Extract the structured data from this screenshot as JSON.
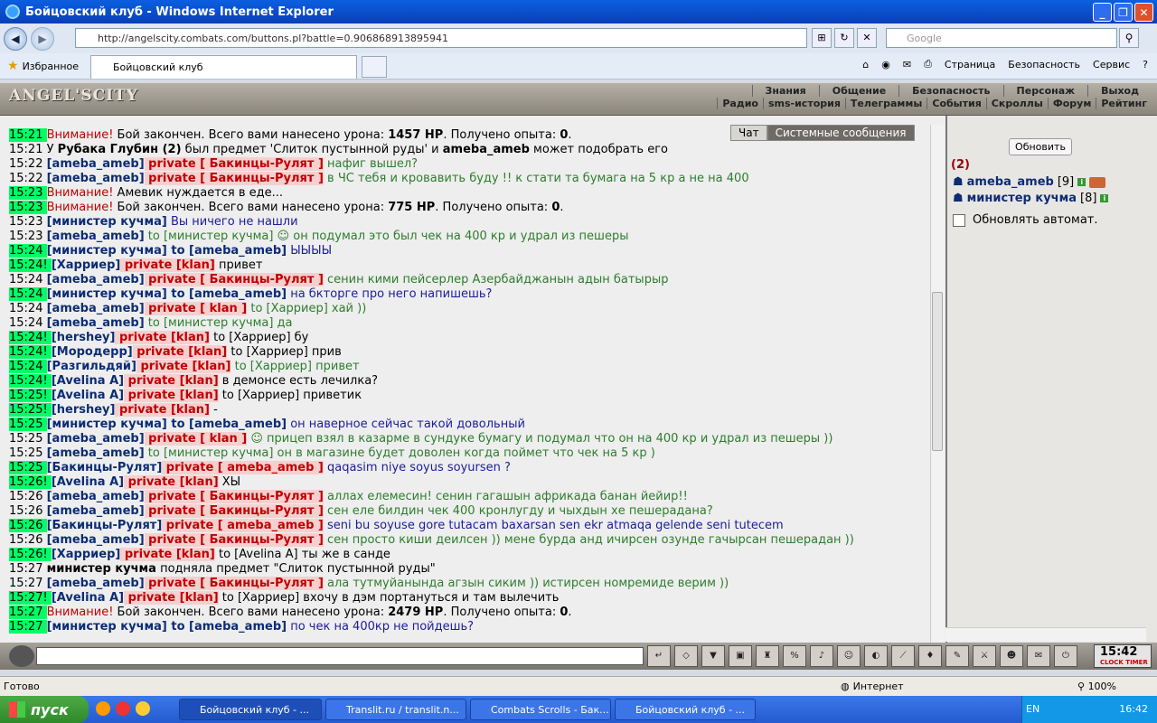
{
  "window": {
    "title": "Бойцовский клуб - Windows Internet Explorer"
  },
  "address": {
    "url": "http://angelscity.combats.com/buttons.pl?battle=0.906868913895941",
    "search_placeholder": "Google"
  },
  "favorites": {
    "label": "Избранное",
    "tab_title": "Бойцовский клуб"
  },
  "cmdbar": {
    "page": "Страница",
    "security": "Безопасность",
    "service": "Сервис"
  },
  "site": {
    "logo": "ANGEL'SCITY",
    "menu": [
      "Знания",
      "Общение",
      "Безопасность",
      "Персонаж",
      "Выход"
    ],
    "submenu": [
      "Радио",
      "sms-история",
      "Телеграммы",
      "События",
      "Скроллы",
      "Форум",
      "Рейтинг"
    ]
  },
  "chat": {
    "tabs": {
      "chat": "Чат",
      "system": "Системные сообщения"
    },
    "lines": [
      {
        "t": "15:21",
        "hl": true,
        "parts": [
          {
            "c": "warn",
            "x": "Внимание!"
          },
          {
            "c": "",
            "x": " Бой закончен. Всего вами нанесено урона: "
          },
          {
            "c": "b",
            "x": "1457 HP"
          },
          {
            "c": "",
            "x": ". Получено опыта: "
          },
          {
            "c": "b",
            "x": "0"
          },
          {
            "c": "",
            "x": "."
          }
        ]
      },
      {
        "t": "15:21",
        "hl": false,
        "parts": [
          {
            "c": "",
            "x": "У "
          },
          {
            "c": "b",
            "x": "Рубака Глубин (2)"
          },
          {
            "c": "",
            "x": " был предмет 'Слиток пустынной руды' и "
          },
          {
            "c": "b",
            "x": "ameba_ameb"
          },
          {
            "c": "",
            "x": " может подобрать его"
          }
        ]
      },
      {
        "t": "15:22",
        "hl": false,
        "parts": [
          {
            "c": "nm",
            "x": "[ameba_ameb]"
          },
          {
            "c": "pr",
            "x": " private [ Бакинцы-Рулят ]"
          },
          {
            "c": "msg",
            "x": " нафиг вышел?"
          }
        ]
      },
      {
        "t": "15:22",
        "hl": false,
        "parts": [
          {
            "c": "nm",
            "x": "[ameba_ameb]"
          },
          {
            "c": "pr",
            "x": " private [ Бакинцы-Рулят ]"
          },
          {
            "c": "msg",
            "x": " в ЧС тебя и кровавить буду !! к стати та бумага на 5 кр а не на 400"
          }
        ]
      },
      {
        "t": "15:23",
        "hl": true,
        "parts": [
          {
            "c": "warn",
            "x": "Внимание!"
          },
          {
            "c": "",
            "x": " Амевик нуждается в еде..."
          }
        ]
      },
      {
        "t": "15:23",
        "hl": true,
        "parts": [
          {
            "c": "warn",
            "x": "Внимание!"
          },
          {
            "c": "",
            "x": " Бой закончен. Всего вами нанесено урона: "
          },
          {
            "c": "b",
            "x": "775 HP"
          },
          {
            "c": "",
            "x": ". Получено опыта: "
          },
          {
            "c": "b",
            "x": "0"
          },
          {
            "c": "",
            "x": "."
          }
        ]
      },
      {
        "t": "15:23",
        "hl": false,
        "parts": [
          {
            "c": "nm",
            "x": "[министер кучма]"
          },
          {
            "c": "msgb",
            "x": " Вы ничего не нашли"
          }
        ]
      },
      {
        "t": "15:23",
        "hl": false,
        "parts": [
          {
            "c": "nm",
            "x": "[ameba_ameb]"
          },
          {
            "c": "msg",
            "x": " to [министер кучма] ☺ он подумал это был чек на 400 кр и удрал из пешеры"
          }
        ]
      },
      {
        "t": "15:24",
        "hl": true,
        "parts": [
          {
            "c": "nm",
            "x": "[министер кучма]"
          },
          {
            "c": "nm",
            "x": " to [ameba_ameb]"
          },
          {
            "c": "msgb",
            "x": " ЫЫЫЫ"
          }
        ]
      },
      {
        "t": "15:24!",
        "hl": true,
        "parts": [
          {
            "c": "nm",
            "x": " [Харриер]"
          },
          {
            "c": "pr",
            "x": " private [klan]"
          },
          {
            "c": "",
            "x": " привет"
          }
        ]
      },
      {
        "t": "15:24",
        "hl": false,
        "parts": [
          {
            "c": "nm",
            "x": "[ameba_ameb]"
          },
          {
            "c": "pr",
            "x": " private [ Бакинцы-Рулят ]"
          },
          {
            "c": "msg",
            "x": " сенин кими пейсерлер Азербайджанын адын батырыр"
          }
        ]
      },
      {
        "t": "15:24",
        "hl": true,
        "parts": [
          {
            "c": "nm",
            "x": "[министер кучма]"
          },
          {
            "c": "nm",
            "x": " to [ameba_ameb]"
          },
          {
            "c": "msgb",
            "x": " на бкторге про него напишешь?"
          }
        ]
      },
      {
        "t": "15:24",
        "hl": false,
        "parts": [
          {
            "c": "nm",
            "x": "[ameba_ameb]"
          },
          {
            "c": "pr",
            "x": " private [ klan ]"
          },
          {
            "c": "msg",
            "x": " to [Харриер] хай ))"
          }
        ]
      },
      {
        "t": "15:24",
        "hl": false,
        "parts": [
          {
            "c": "nm",
            "x": "[ameba_ameb]"
          },
          {
            "c": "msg",
            "x": " to [министер кучма] да"
          }
        ]
      },
      {
        "t": "15:24!",
        "hl": true,
        "parts": [
          {
            "c": "nm",
            "x": " [hershey]"
          },
          {
            "c": "pr",
            "x": " private [klan]"
          },
          {
            "c": "",
            "x": " to [Харриер] бу"
          }
        ]
      },
      {
        "t": "15:24!",
        "hl": true,
        "parts": [
          {
            "c": "nm",
            "x": " [Мородерр]"
          },
          {
            "c": "pr",
            "x": " private [klan]"
          },
          {
            "c": "",
            "x": " to [Харриер] прив"
          }
        ]
      },
      {
        "t": "15:24",
        "hl": true,
        "parts": [
          {
            "c": "nm",
            "x": "[Разгильдяй]"
          },
          {
            "c": "pr",
            "x": " private [klan]"
          },
          {
            "c": "msg",
            "x": " to [Харриер] привет"
          }
        ]
      },
      {
        "t": "15:24!",
        "hl": true,
        "parts": [
          {
            "c": "nm",
            "x": " [Avelina A]"
          },
          {
            "c": "pr",
            "x": " private [klan]"
          },
          {
            "c": "",
            "x": " в демонсе есть лечилка?"
          }
        ]
      },
      {
        "t": "15:25!",
        "hl": true,
        "parts": [
          {
            "c": "nm",
            "x": " [Avelina A]"
          },
          {
            "c": "pr",
            "x": " private [klan]"
          },
          {
            "c": "",
            "x": " to [Харриер] приветик"
          }
        ]
      },
      {
        "t": "15:25!",
        "hl": true,
        "parts": [
          {
            "c": "nm",
            "x": " [hershey]"
          },
          {
            "c": "pr",
            "x": " private [klan]"
          },
          {
            "c": "",
            "x": " -"
          }
        ]
      },
      {
        "t": "15:25",
        "hl": true,
        "parts": [
          {
            "c": "nm",
            "x": "[министер кучма]"
          },
          {
            "c": "nm",
            "x": " to [ameba_ameb]"
          },
          {
            "c": "msgb",
            "x": " он наверное сейчас такой довольный"
          }
        ]
      },
      {
        "t": "15:25",
        "hl": false,
        "parts": [
          {
            "c": "nm",
            "x": "[ameba_ameb]"
          },
          {
            "c": "pr",
            "x": " private [ klan ]"
          },
          {
            "c": "msg",
            "x": " ☺ прицеп взял в казарме в сундуке бумагу и подумал что он на 400 кр и удрал из пешеры ))"
          }
        ]
      },
      {
        "t": "15:25",
        "hl": false,
        "parts": [
          {
            "c": "nm",
            "x": "[ameba_ameb]"
          },
          {
            "c": "msg",
            "x": " to [министер кучма] он в магазине будет доволен когда поймет что чек на 5 кр )"
          }
        ]
      },
      {
        "t": "15:25",
        "hl": true,
        "parts": [
          {
            "c": "nm",
            "x": "[Бакинцы-Рулят]"
          },
          {
            "c": "pr",
            "x": " private [ ameba_ameb ]"
          },
          {
            "c": "msgb",
            "x": " qaqasim niye soyus soyursen ?"
          }
        ]
      },
      {
        "t": "15:26!",
        "hl": true,
        "parts": [
          {
            "c": "nm",
            "x": " [Avelina A]"
          },
          {
            "c": "pr",
            "x": " private [klan]"
          },
          {
            "c": "",
            "x": " ХЫ"
          }
        ]
      },
      {
        "t": "15:26",
        "hl": false,
        "parts": [
          {
            "c": "nm",
            "x": "[ameba_ameb]"
          },
          {
            "c": "pr",
            "x": " private [ Бакинцы-Рулят ]"
          },
          {
            "c": "msg",
            "x": " аллах елемесин! сенин гагашын африкада банан йейир!!"
          }
        ]
      },
      {
        "t": "15:26",
        "hl": false,
        "parts": [
          {
            "c": "nm",
            "x": "[ameba_ameb]"
          },
          {
            "c": "pr",
            "x": " private [ Бакинцы-Рулят ]"
          },
          {
            "c": "msg",
            "x": " сен еле билдин чек 400 кронлугду и чыхдын хе пешерадана?"
          }
        ]
      },
      {
        "t": "15:26",
        "hl": true,
        "parts": [
          {
            "c": "nm",
            "x": "[Бакинцы-Рулят]"
          },
          {
            "c": "pr",
            "x": " private [ ameba_ameb ]"
          },
          {
            "c": "msgb",
            "x": " seni bu soyuse gore tutacam baxarsan sen ekr atmaqa gelende seni tutecem"
          }
        ]
      },
      {
        "t": "15:26",
        "hl": false,
        "parts": [
          {
            "c": "nm",
            "x": "[ameba_ameb]"
          },
          {
            "c": "pr",
            "x": " private [ Бакинцы-Рулят ]"
          },
          {
            "c": "msg",
            "x": " сен просто киши деилсен )) мене бурда анд ичирсен озунде гачырсан пешерадан ))"
          }
        ]
      },
      {
        "t": "15:26!",
        "hl": true,
        "parts": [
          {
            "c": "nm",
            "x": " [Харриер]"
          },
          {
            "c": "pr",
            "x": " private [klan]"
          },
          {
            "c": "",
            "x": " to [Avelina A] ты же в санде"
          }
        ]
      },
      {
        "t": "15:27",
        "hl": false,
        "parts": [
          {
            "c": "b",
            "x": "министер кучма"
          },
          {
            "c": "",
            "x": " подняла предмет \"Слиток пустынной руды\""
          }
        ]
      },
      {
        "t": "15:27",
        "hl": false,
        "parts": [
          {
            "c": "nm",
            "x": "[ameba_ameb]"
          },
          {
            "c": "pr",
            "x": " private [ Бакинцы-Рулят ]"
          },
          {
            "c": "msg",
            "x": " ала тутмуйанында агзын сиким )) истирсен номремиде верим ))"
          }
        ]
      },
      {
        "t": "15:27!",
        "hl": true,
        "parts": [
          {
            "c": "nm",
            "x": " [Avelina A]"
          },
          {
            "c": "pr",
            "x": " private [klan]"
          },
          {
            "c": "",
            "x": " to [Харриер] вхочу в дэм портануться и там вылечить"
          }
        ]
      },
      {
        "t": "15:27",
        "hl": true,
        "parts": [
          {
            "c": "warn",
            "x": "Внимание!"
          },
          {
            "c": "",
            "x": " Бой закончен. Всего вами нанесено урона: "
          },
          {
            "c": "b",
            "x": "2479 HP"
          },
          {
            "c": "",
            "x": ". Получено опыта: "
          },
          {
            "c": "b",
            "x": "0"
          },
          {
            "c": "",
            "x": "."
          }
        ]
      },
      {
        "t": "15:27",
        "hl": true,
        "parts": [
          {
            "c": "nm",
            "x": "[министер кучма]"
          },
          {
            "c": "nm",
            "x": " to [ameba_ameb]"
          },
          {
            "c": "msgb",
            "x": " по чек на 400кр не пойдешь?"
          }
        ]
      }
    ]
  },
  "sidebar": {
    "refresh": "Обновить",
    "count": "(2)",
    "users": [
      {
        "name": "ameba_ameb",
        "level": "[9]"
      },
      {
        "name": "министер кучма",
        "level": "[8]"
      }
    ],
    "auto_refresh": "Обновлять автомат."
  },
  "inputbar": {
    "clock_time": "15:42",
    "clock_label": "CLOCK TIMER"
  },
  "status": {
    "left": "Готово",
    "zone": "Интернет",
    "zoom": "100%"
  },
  "taskbar": {
    "start": "пуск",
    "tasks": [
      "Бойцовский клуб - ...",
      "Translit.ru / translit.n...",
      "Combats Scrolls - Бак...",
      "Бойцовский клуб - ..."
    ],
    "lang": "EN",
    "time": "16:42"
  }
}
